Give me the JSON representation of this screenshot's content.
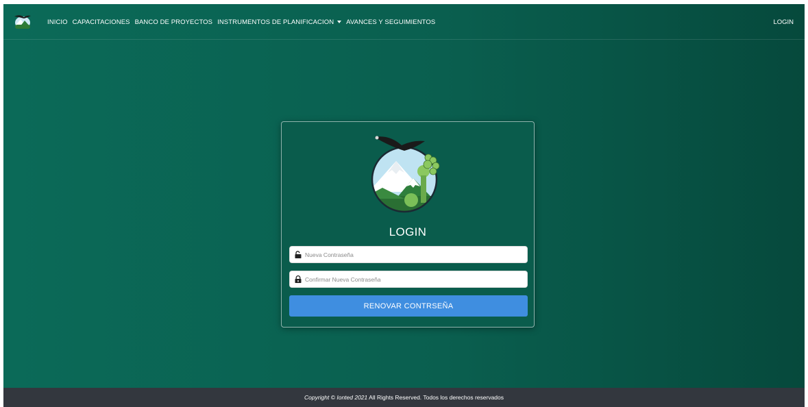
{
  "navbar": {
    "logo_icon": "condor-mountain-logo-icon",
    "links": [
      {
        "label": "INICIO"
      },
      {
        "label": "CAPACITACIONES"
      },
      {
        "label": "BANCO DE PROYECTOS"
      },
      {
        "label": "INSTRUMENTOS DE PLANIFICACION",
        "dropdown": true
      },
      {
        "label": "AVANCES Y SEGUIMIENTOS"
      }
    ],
    "login_label": "LOGIN"
  },
  "card": {
    "logo_icon": "condor-mountain-logo-icon",
    "title": "LOGIN",
    "new_password": {
      "placeholder": "Nueva Contraseña",
      "value": "",
      "icon": "lock-open-icon"
    },
    "confirm_password": {
      "placeholder": "Confirmar Nueva Contraseña",
      "value": "",
      "icon": "lock-icon"
    },
    "submit_label": "RENOVAR CONTRSEÑA"
  },
  "footer": {
    "copyright_italic": "Copyright © Ionted 2021",
    "copyright_rest": " All Rights Reserved. Todos los derechos reservados"
  },
  "colors": {
    "background_start": "#0b6a58",
    "background_end": "#06493c",
    "button": "#3f8ee0",
    "footer": "#33373e"
  }
}
